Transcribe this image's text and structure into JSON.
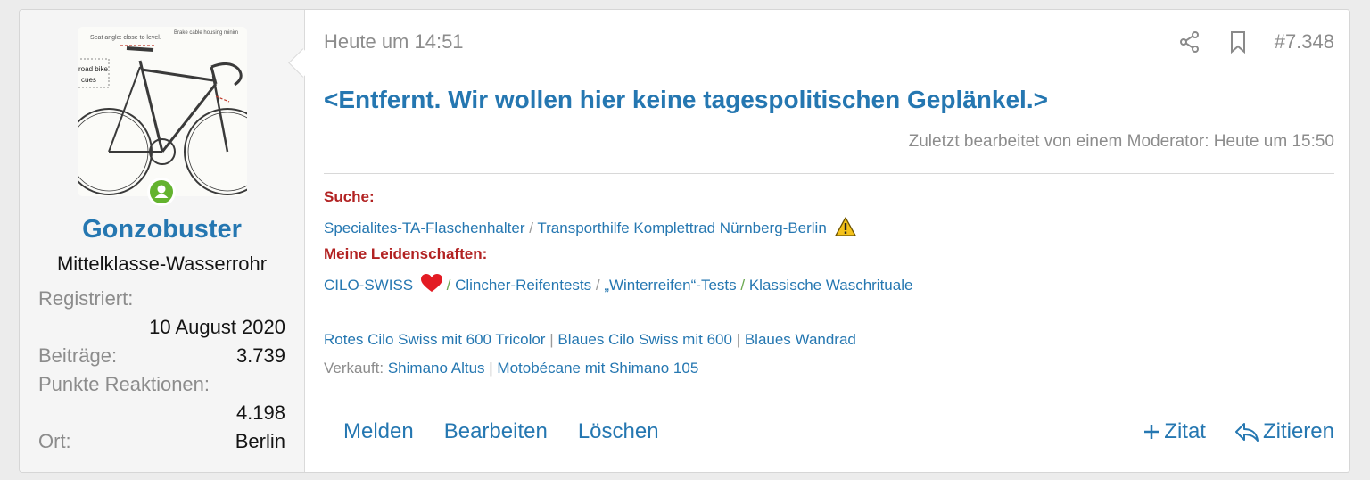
{
  "user": {
    "name": "Gonzobuster",
    "title": "Mittelklasse-Wasserrohr",
    "avatar_caption_left": "Seat angle: close to level.",
    "avatar_caption_right": "Brake cable housing minimum yet arching.",
    "avatar_note_line1": "road bike",
    "avatar_note_line2": "cues",
    "stats": [
      {
        "label": "Registriert:",
        "value": "10 August 2020"
      },
      {
        "label": "Beiträge:",
        "value": "3.739"
      },
      {
        "label": "Punkte Reaktionen:",
        "value": "4.198"
      },
      {
        "label": "Ort:",
        "value": "Berlin"
      }
    ]
  },
  "post": {
    "date": "Heute um 14:51",
    "number": "#7.348",
    "message": "<Entfernt. Wir wollen hier keine tagespolitischen Geplänkel.>",
    "edited_note": "Zuletzt bearbeitet von einem Moderator: Heute um 15:50"
  },
  "signature": {
    "suche_label": "Suche:",
    "suche_links": [
      "Specialites-TA-Flaschenhalter",
      "Transporthilfe Komplettrad Nürnberg-Berlin"
    ],
    "leidenschaften_label": "Meine Leidenschaften:",
    "leidenschaften_links": [
      "CILO-SWISS",
      "Clincher-Reifentests",
      "„Winterreifen“-Tests",
      "Klassische Waschrituale"
    ],
    "bikes": [
      "Rotes Cilo Swiss mit 600 Tricolor",
      "Blaues Cilo Swiss mit 600",
      "Blaues Wandrad"
    ],
    "verkauft_label": "Verkauft:",
    "verkauft_links": [
      "Shimano Altus",
      "Motobécane mit Shimano 105"
    ],
    "slash": "/",
    "pipe": "|"
  },
  "actions": {
    "melden": "Melden",
    "bearbeiten": "Bearbeiten",
    "loeschen": "Löschen",
    "zitat": "Zitat",
    "zitieren": "Zitieren"
  },
  "colors": {
    "accent": "#2577b1",
    "red": "#b22222",
    "online": "#63b32e"
  }
}
